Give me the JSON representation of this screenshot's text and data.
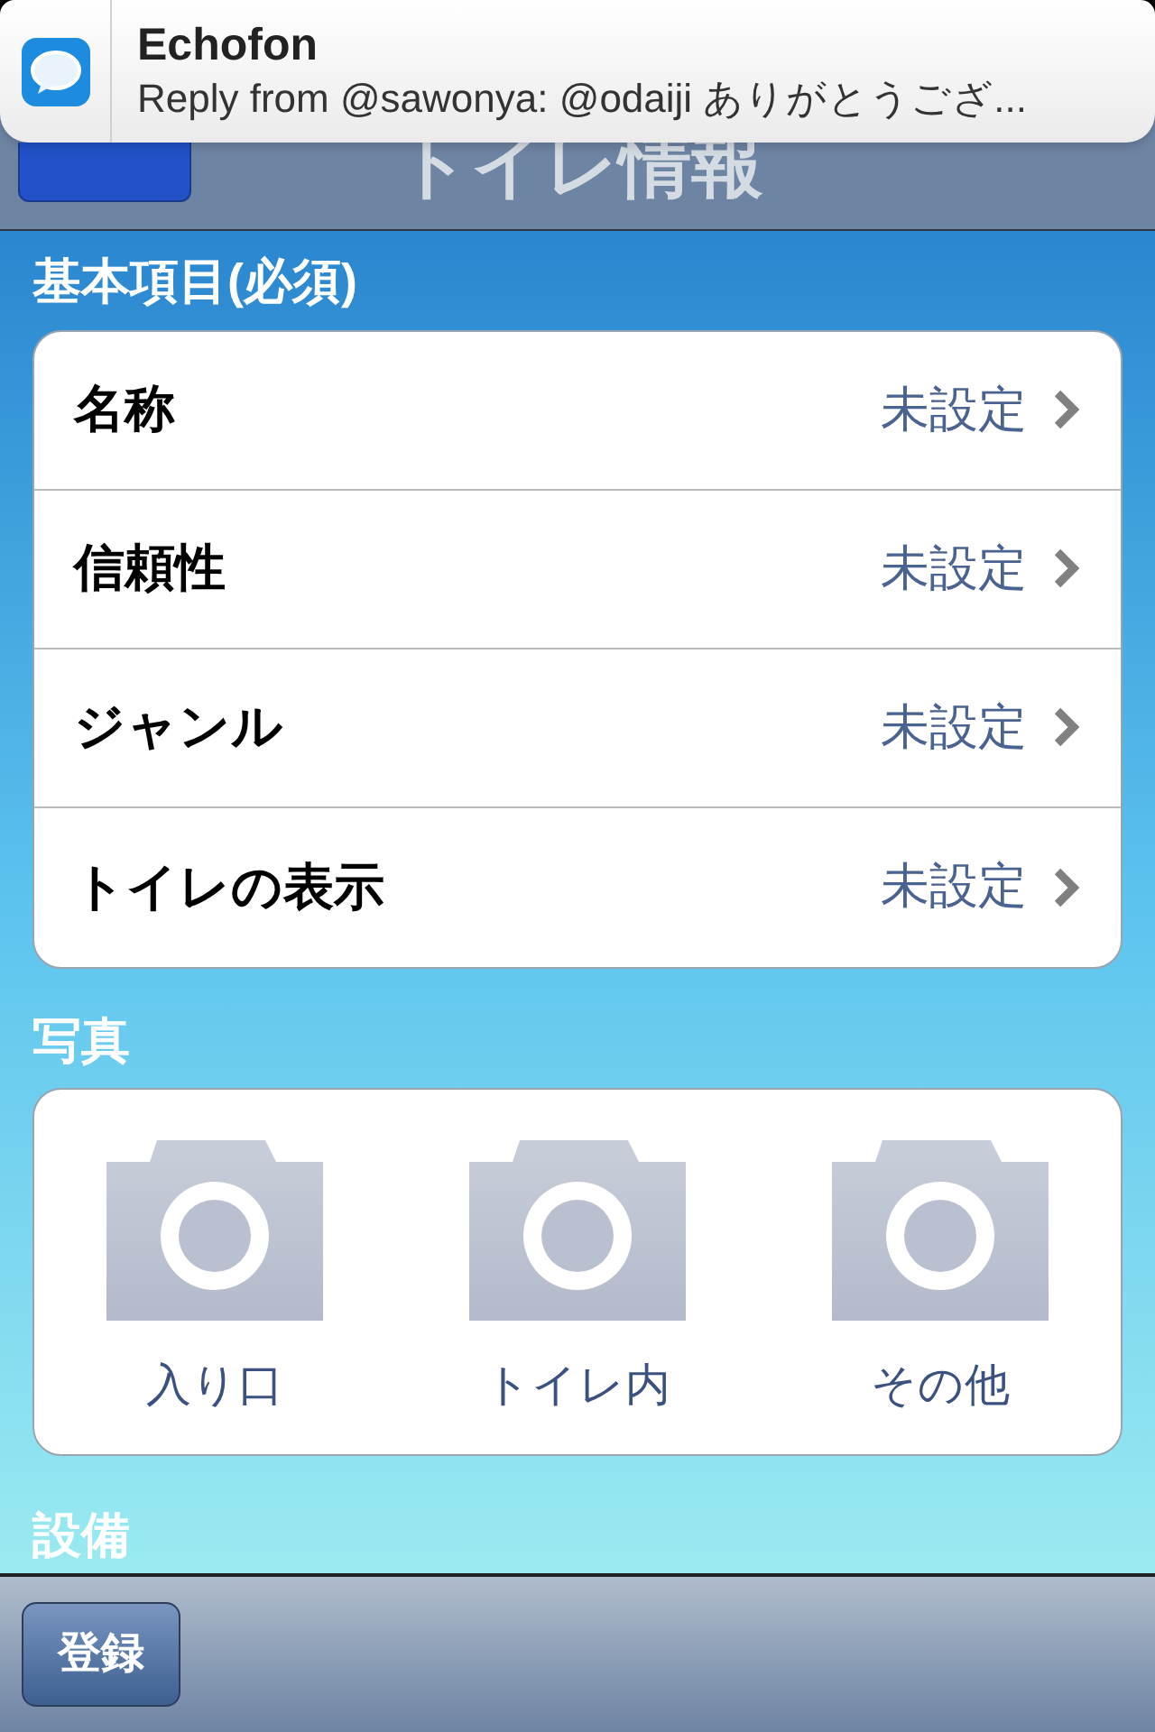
{
  "notification": {
    "app": "Echofon",
    "message": "Reply from @sawonya: @odaiji ありがとうござ..."
  },
  "nav_bar": {
    "title": "トイレ情報"
  },
  "basic_section": {
    "header": "基本項目(必須)",
    "rows": [
      {
        "label": "名称",
        "value": "未設定"
      },
      {
        "label": "信頼性",
        "value": "未設定"
      },
      {
        "label": "ジャンル",
        "value": "未設定"
      },
      {
        "label": "トイレの表示",
        "value": "未設定"
      }
    ]
  },
  "photo_section": {
    "header": "写真",
    "items": [
      {
        "label": "入り口"
      },
      {
        "label": "トイレ内"
      },
      {
        "label": "その他"
      }
    ]
  },
  "equipment_section": {
    "header": "設備"
  },
  "toolbar": {
    "button": "登録"
  }
}
